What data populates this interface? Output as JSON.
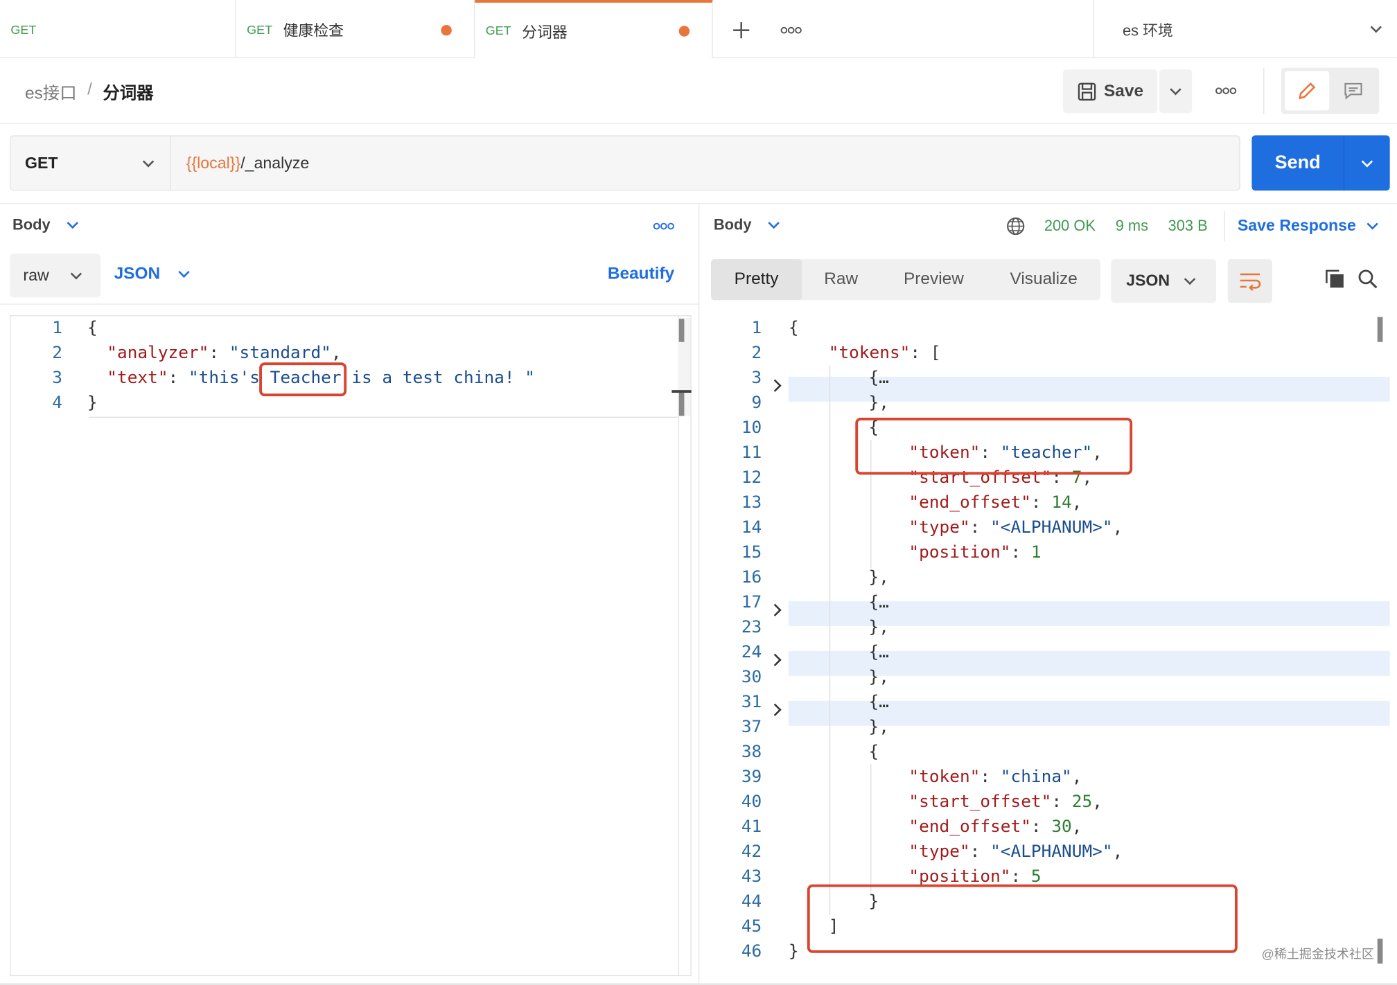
{
  "tabs": [
    {
      "method": "GET",
      "title": "",
      "modified": false,
      "active": false
    },
    {
      "method": "GET",
      "title": "健康检查",
      "modified": true,
      "active": false
    },
    {
      "method": "GET",
      "title": "分词器",
      "modified": true,
      "active": true
    }
  ],
  "tabbar": {
    "add_icon": "plus-icon",
    "more_icon": "more-icon"
  },
  "environment": {
    "label": "es 环境"
  },
  "breadcrumb": {
    "collection": "es接口",
    "separator": "/",
    "request": "分词器"
  },
  "toolbar": {
    "save_label": "Save",
    "more_icon": "more-icon",
    "edit_icon": "pencil-icon",
    "comment_icon": "comment-icon"
  },
  "request": {
    "method": "GET",
    "url_var": "{{local}}",
    "url_path": "/_analyze",
    "send_label": "Send"
  },
  "left_panel": {
    "section": "Body",
    "body_mode": "raw",
    "body_format": "JSON",
    "beautify_label": "Beautify",
    "line_numbers": [
      "1",
      "2",
      "3",
      "4"
    ],
    "lines": [
      {
        "indent": 0,
        "parts": [
          {
            "t": "p",
            "v": "{"
          }
        ]
      },
      {
        "indent": 1,
        "parts": [
          {
            "t": "k",
            "v": "\"analyzer\""
          },
          {
            "t": "p",
            "v": ": "
          },
          {
            "t": "s",
            "v": "\"standard\""
          },
          {
            "t": "p",
            "v": ","
          }
        ]
      },
      {
        "indent": 1,
        "parts": [
          {
            "t": "k",
            "v": "\"text\""
          },
          {
            "t": "p",
            "v": ": "
          },
          {
            "t": "s",
            "v": "\"this's Teacher is a test china! \""
          }
        ]
      },
      {
        "indent": 0,
        "parts": [
          {
            "t": "p",
            "v": "}"
          }
        ]
      }
    ]
  },
  "right_panel": {
    "section": "Body",
    "status": "200 OK",
    "time": "9 ms",
    "size": "303 B",
    "save_response_label": "Save Response",
    "view_tabs": [
      "Pretty",
      "Raw",
      "Preview",
      "Visualize"
    ],
    "active_view": "Pretty",
    "format": "JSON",
    "watermark": "@稀土掘金技术社区",
    "line_numbers": [
      "1",
      "2",
      "3",
      "9",
      "10",
      "11",
      "12",
      "13",
      "14",
      "15",
      "16",
      "17",
      "23",
      "24",
      "30",
      "31",
      "37",
      "38",
      "39",
      "40",
      "41",
      "42",
      "43",
      "44",
      "45",
      "46"
    ],
    "lines": [
      {
        "indent": 0,
        "folded": false,
        "parts": [
          {
            "t": "p",
            "v": "{"
          }
        ]
      },
      {
        "indent": 1,
        "folded": false,
        "parts": [
          {
            "t": "k",
            "v": "\"tokens\""
          },
          {
            "t": "p",
            "v": ": ["
          }
        ]
      },
      {
        "indent": 2,
        "folded": true,
        "parts": [
          {
            "t": "p",
            "v": "{…"
          }
        ]
      },
      {
        "indent": 2,
        "folded": false,
        "parts": [
          {
            "t": "p",
            "v": "},"
          }
        ]
      },
      {
        "indent": 2,
        "folded": false,
        "parts": [
          {
            "t": "p",
            "v": "{"
          }
        ]
      },
      {
        "indent": 3,
        "folded": false,
        "parts": [
          {
            "t": "k",
            "v": "\"token\""
          },
          {
            "t": "p",
            "v": ": "
          },
          {
            "t": "s",
            "v": "\"teacher\""
          },
          {
            "t": "p",
            "v": ","
          }
        ]
      },
      {
        "indent": 3,
        "folded": false,
        "parts": [
          {
            "t": "k",
            "v": "\"start_offset\""
          },
          {
            "t": "p",
            "v": ": "
          },
          {
            "t": "n",
            "v": "7"
          },
          {
            "t": "p",
            "v": ","
          }
        ]
      },
      {
        "indent": 3,
        "folded": false,
        "parts": [
          {
            "t": "k",
            "v": "\"end_offset\""
          },
          {
            "t": "p",
            "v": ": "
          },
          {
            "t": "n",
            "v": "14"
          },
          {
            "t": "p",
            "v": ","
          }
        ]
      },
      {
        "indent": 3,
        "folded": false,
        "parts": [
          {
            "t": "k",
            "v": "\"type\""
          },
          {
            "t": "p",
            "v": ": "
          },
          {
            "t": "s",
            "v": "\"<ALPHANUM>\""
          },
          {
            "t": "p",
            "v": ","
          }
        ]
      },
      {
        "indent": 3,
        "folded": false,
        "parts": [
          {
            "t": "k",
            "v": "\"position\""
          },
          {
            "t": "p",
            "v": ": "
          },
          {
            "t": "n",
            "v": "1"
          }
        ]
      },
      {
        "indent": 2,
        "folded": false,
        "parts": [
          {
            "t": "p",
            "v": "},"
          }
        ]
      },
      {
        "indent": 2,
        "folded": true,
        "parts": [
          {
            "t": "p",
            "v": "{…"
          }
        ]
      },
      {
        "indent": 2,
        "folded": false,
        "parts": [
          {
            "t": "p",
            "v": "},"
          }
        ]
      },
      {
        "indent": 2,
        "folded": true,
        "parts": [
          {
            "t": "p",
            "v": "{…"
          }
        ]
      },
      {
        "indent": 2,
        "folded": false,
        "parts": [
          {
            "t": "p",
            "v": "},"
          }
        ]
      },
      {
        "indent": 2,
        "folded": true,
        "parts": [
          {
            "t": "p",
            "v": "{…"
          }
        ]
      },
      {
        "indent": 2,
        "folded": false,
        "parts": [
          {
            "t": "p",
            "v": "},"
          }
        ]
      },
      {
        "indent": 2,
        "folded": false,
        "parts": [
          {
            "t": "p",
            "v": "{"
          }
        ]
      },
      {
        "indent": 3,
        "folded": false,
        "parts": [
          {
            "t": "k",
            "v": "\"token\""
          },
          {
            "t": "p",
            "v": ": "
          },
          {
            "t": "s",
            "v": "\"china\""
          },
          {
            "t": "p",
            "v": ","
          }
        ]
      },
      {
        "indent": 3,
        "folded": false,
        "parts": [
          {
            "t": "k",
            "v": "\"start_offset\""
          },
          {
            "t": "p",
            "v": ": "
          },
          {
            "t": "n",
            "v": "25"
          },
          {
            "t": "p",
            "v": ","
          }
        ]
      },
      {
        "indent": 3,
        "folded": false,
        "parts": [
          {
            "t": "k",
            "v": "\"end_offset\""
          },
          {
            "t": "p",
            "v": ": "
          },
          {
            "t": "n",
            "v": "30"
          },
          {
            "t": "p",
            "v": ","
          }
        ]
      },
      {
        "indent": 3,
        "folded": false,
        "parts": [
          {
            "t": "k",
            "v": "\"type\""
          },
          {
            "t": "p",
            "v": ": "
          },
          {
            "t": "s",
            "v": "\"<ALPHANUM>\""
          },
          {
            "t": "p",
            "v": ","
          }
        ]
      },
      {
        "indent": 3,
        "folded": false,
        "parts": [
          {
            "t": "k",
            "v": "\"position\""
          },
          {
            "t": "p",
            "v": ": "
          },
          {
            "t": "n",
            "v": "5"
          }
        ]
      },
      {
        "indent": 2,
        "folded": false,
        "parts": [
          {
            "t": "p",
            "v": "}"
          }
        ]
      },
      {
        "indent": 1,
        "folded": false,
        "parts": [
          {
            "t": "p",
            "v": "]"
          }
        ]
      },
      {
        "indent": 0,
        "folded": false,
        "parts": [
          {
            "t": "p",
            "v": "}"
          }
        ]
      }
    ]
  },
  "colors": {
    "accent": "#1f6ee0",
    "tab_active": "#e8753a",
    "status_ok": "#3f9b4f",
    "highlight_box": "#d9432f",
    "method_get": "#3f9b4f",
    "url_variable": "#e8753a"
  }
}
